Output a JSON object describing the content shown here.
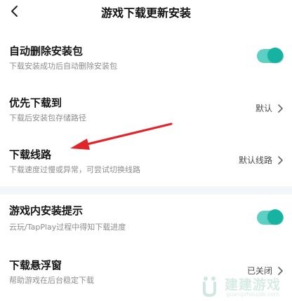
{
  "header": {
    "title": "游戏下载更新安装",
    "back_icon": "chevron-left-icon"
  },
  "settings": [
    {
      "title": "自动删除安装包",
      "subtitle": "下载安装成功后自动删除安装包",
      "control": "toggle",
      "enabled": true
    },
    {
      "title": "优先下载到",
      "subtitle": "下载后安装包存储路径",
      "value": "默认",
      "control": "chevron"
    },
    {
      "title": "下载线路",
      "subtitle": "下载速度过慢或异常，可尝试切换线路",
      "value": "默认线路",
      "control": "chevron"
    },
    {
      "title": "游戏内安装提示",
      "subtitle": "云玩/TapPlay过程中得知下载进度",
      "control": "toggle",
      "enabled": true
    },
    {
      "title": "下载悬浮窗",
      "subtitle": "帮助游戏在后台稳定下载",
      "value": "已关闭",
      "control": "chevron"
    }
  ],
  "colors": {
    "toggle_track": "#5cd0c2",
    "toggle_knob": "#16b3a3",
    "annotation_arrow": "#e0262b",
    "divider": "#f4f5f6"
  },
  "watermark": {
    "text": "建建游戏",
    "url": "guangzhoujob.com"
  }
}
